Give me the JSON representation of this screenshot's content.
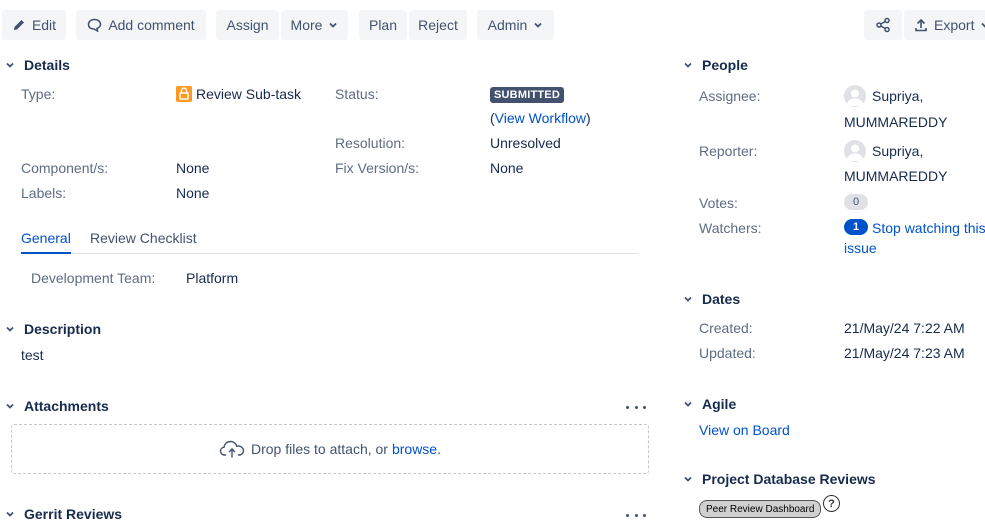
{
  "toolbar": {
    "edit": "Edit",
    "add_comment": "Add comment",
    "assign": "Assign",
    "more": "More",
    "plan": "Plan",
    "reject": "Reject",
    "admin": "Admin",
    "export": "Export"
  },
  "details": {
    "title": "Details",
    "type_label": "Type:",
    "type_value": "Review Sub-task",
    "status_label": "Status:",
    "status_value": "SUBMITTED",
    "view_workflow": "View Workflow",
    "resolution_label": "Resolution:",
    "resolution_value": "Unresolved",
    "components_label": "Component/s:",
    "components_value": "None",
    "fix_version_label": "Fix Version/s:",
    "fix_version_value": "None",
    "labels_label": "Labels:",
    "labels_value": "None"
  },
  "tabs": {
    "general": "General",
    "review_checklist": "Review Checklist"
  },
  "general": {
    "dev_team_label": "Development Team:",
    "dev_team_value": "Platform"
  },
  "description": {
    "title": "Description",
    "text": "test"
  },
  "attachments": {
    "title": "Attachments",
    "drop_text": "Drop files to attach, or",
    "browse": "browse."
  },
  "gerrit": {
    "title": "Gerrit Reviews"
  },
  "people": {
    "title": "People",
    "assignee_label": "Assignee:",
    "assignee_line1": "Supriya,",
    "assignee_line2": "MUMMAREDDY",
    "reporter_label": "Reporter:",
    "reporter_line1": "Supriya,",
    "reporter_line2": "MUMMAREDDY",
    "votes_label": "Votes:",
    "votes_count": "0",
    "watchers_label": "Watchers:",
    "watchers_count": "1",
    "stop_watching_line1": "Stop watching this",
    "stop_watching_line2": "issue"
  },
  "dates": {
    "title": "Dates",
    "created_label": "Created:",
    "created_value": "21/May/24 7:22 AM",
    "updated_label": "Updated:",
    "updated_value": "21/May/24 7:23 AM"
  },
  "agile": {
    "title": "Agile",
    "view_on_board": "View on Board"
  },
  "project_db": {
    "title": "Project Database Reviews",
    "button": "Peer Review Dashboard",
    "help": "?"
  },
  "colors": {
    "link": "#0052cc",
    "lozenge": "#42526e",
    "subtask_icon": "#ff991f"
  }
}
